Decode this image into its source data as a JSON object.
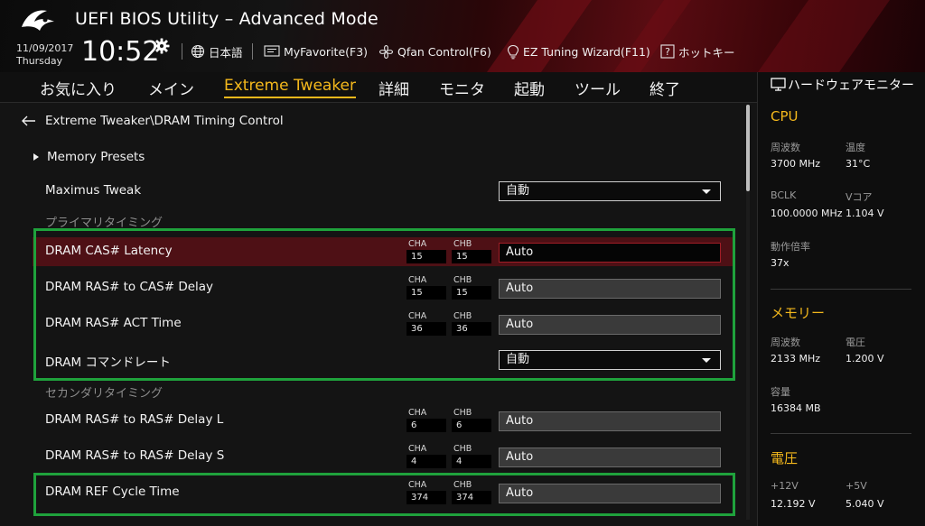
{
  "header": {
    "title": "UEFI BIOS Utility – Advanced Mode",
    "date": "11/09/2017",
    "weekday": "Thursday",
    "time": "10:52",
    "tools": [
      {
        "id": "language",
        "label": "日本語",
        "icon": "globe-icon"
      },
      {
        "id": "myfavorite",
        "label": "MyFavorite(F3)",
        "icon": "favorite-icon"
      },
      {
        "id": "qfan",
        "label": "Qfan Control(F6)",
        "icon": "fan-icon"
      },
      {
        "id": "eztuning",
        "label": "EZ Tuning Wizard(F11)",
        "icon": "lightbulb-icon"
      },
      {
        "id": "hotkeys",
        "label": "ホットキー",
        "icon": "help-icon"
      }
    ]
  },
  "menu": {
    "items": [
      "お気に入り",
      "メイン",
      "Extreme Tweaker",
      "詳細",
      "モニタ",
      "起動",
      "ツール",
      "終了"
    ],
    "active": "Extreme Tweaker"
  },
  "main": {
    "breadcrumb": "Extreme Tweaker\\DRAM Timing Control",
    "submenu": "Memory Presets",
    "maximus_tweak": {
      "label": "Maximus Tweak",
      "value": "自動"
    },
    "primary_section": "プライマリタイミング",
    "secondary_section": "セカンダリタイミング",
    "channel_labels": {
      "a": "CHA",
      "b": "CHB"
    },
    "primary_rows": [
      {
        "label": "DRAM CAS# Latency",
        "cha": "15",
        "chb": "15",
        "value": "Auto"
      },
      {
        "label": "DRAM RAS# to CAS# Delay",
        "cha": "15",
        "chb": "15",
        "value": "Auto"
      },
      {
        "label": "DRAM RAS# ACT Time",
        "cha": "36",
        "chb": "36",
        "value": "Auto"
      },
      {
        "label": "DRAM コマンドレート",
        "value": "自動"
      }
    ],
    "secondary_rows": [
      {
        "label": "DRAM RAS# to RAS# Delay L",
        "cha": "6",
        "chb": "6",
        "value": "Auto"
      },
      {
        "label": "DRAM RAS# to RAS# Delay S",
        "cha": "4",
        "chb": "4",
        "value": "Auto"
      },
      {
        "label": "DRAM REF Cycle Time",
        "cha": "374",
        "chb": "374",
        "value": "Auto"
      }
    ]
  },
  "hwmon": {
    "title": "ハードウェアモニター",
    "cpu": {
      "heading": "CPU",
      "freq_label": "周波数",
      "freq_value": "3700 MHz",
      "temp_label": "温度",
      "temp_value": "31°C",
      "bclk_label": "BCLK",
      "bclk_value": "100.0000 MHz",
      "vcore_label": "Vコア",
      "vcore_value": "1.104 V",
      "ratio_label": "動作倍率",
      "ratio_value": "37x"
    },
    "memory": {
      "heading": "メモリー",
      "freq_label": "周波数",
      "freq_value": "2133 MHz",
      "volt_label": "電圧",
      "volt_value": "1.200 V",
      "cap_label": "容量",
      "cap_value": "16384 MB"
    },
    "voltage": {
      "heading": "電圧",
      "v12_label": "+12V",
      "v12_value": "12.192 V",
      "v5_label": "+5V",
      "v5_value": "5.040 V"
    }
  },
  "colors": {
    "accent": "#f4b81c",
    "highlight_row": "#4e1015",
    "annotation": "#1fa23c"
  }
}
